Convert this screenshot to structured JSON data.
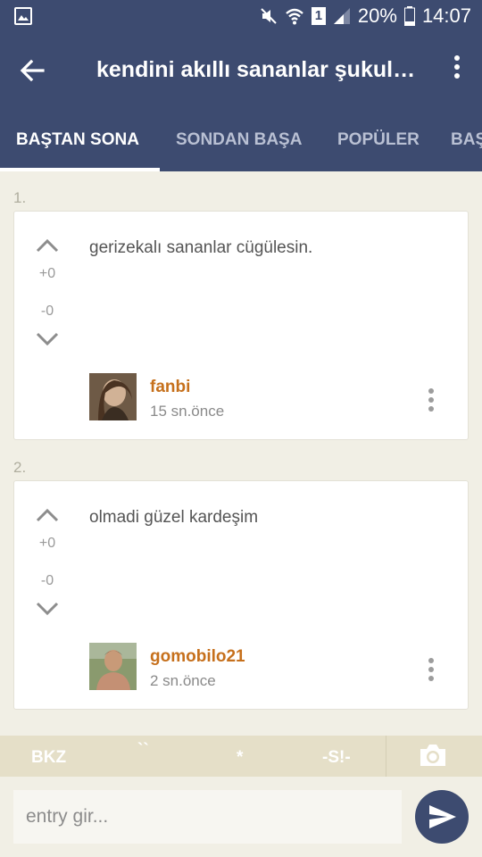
{
  "status_bar": {
    "battery": "20%",
    "time": "14:07",
    "sim_slot": "1"
  },
  "app_bar": {
    "title": "kendini akıllı sananlar şukul…"
  },
  "tabs": [
    {
      "label": "BAŞTAN SONA",
      "active": true
    },
    {
      "label": "SONDAN BAŞA",
      "active": false
    },
    {
      "label": "POPÜLER",
      "active": false
    },
    {
      "label": "BAŞ",
      "active": false
    }
  ],
  "entries": [
    {
      "number": "1.",
      "text": "gerizekalı sananlar cügülesin.",
      "upvotes": "+0",
      "downvotes": "-0",
      "author": "fanbi",
      "time": "15 sn.önce"
    },
    {
      "number": "2.",
      "text": "olmadi güzel kardeşim",
      "upvotes": "+0",
      "downvotes": "-0",
      "author": "gomobilo21",
      "time": "2 sn.önce"
    }
  ],
  "toolbar": {
    "bkz": "BKZ",
    "backtick": "``",
    "star": "*",
    "spoiler": "-S!-"
  },
  "input": {
    "placeholder": "entry gir..."
  },
  "colors": {
    "primary": "#3d4b70",
    "background": "#f1efe5",
    "author": "#c6701c",
    "toolbar": "#e5dfc8"
  }
}
